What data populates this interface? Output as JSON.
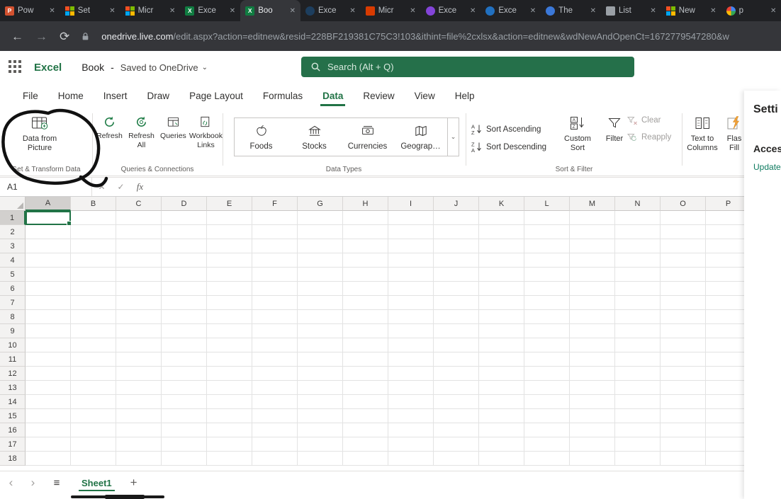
{
  "colors": {
    "excel_green": "#217346",
    "search_bg": "#25704a",
    "link": "#0e7a5f",
    "marker": "#111111"
  },
  "browser": {
    "tabs": [
      {
        "label": "Pow",
        "icon": "square",
        "color": "#d35230",
        "letter": "P"
      },
      {
        "label": "Set",
        "icon": "ms"
      },
      {
        "label": "Micr",
        "icon": "ms"
      },
      {
        "label": "Exce",
        "icon": "excel"
      },
      {
        "label": "Boo",
        "icon": "excel",
        "active": true
      },
      {
        "label": "Exce",
        "icon": "circle",
        "color": "#1d3e5e"
      },
      {
        "label": "Micr",
        "icon": "square",
        "color": "#d83b01"
      },
      {
        "label": "Exce",
        "icon": "circle",
        "color": "#8344d8"
      },
      {
        "label": "Exce",
        "icon": "circle",
        "color": "#2170c0"
      },
      {
        "label": "The",
        "icon": "circle",
        "color": "#3b78d8"
      },
      {
        "label": "List",
        "icon": "square",
        "color": "#9aa0a6"
      },
      {
        "label": "New",
        "icon": "ms"
      },
      {
        "label": "p",
        "icon": "google"
      }
    ],
    "close_glyph": "✕",
    "back_glyph": "←",
    "forward_glyph": "→",
    "reload_glyph": "⟳",
    "url_domain": "onedrive.live.com",
    "url_path": "/edit.aspx?action=editnew&resid=228BF219381C75C3!103&ithint=file%2cxlsx&action=editnew&wdNewAndOpenCt=1672779547280&w"
  },
  "app_header": {
    "app_name": "Excel",
    "doc_name": "Book",
    "dash": "-",
    "saved_status": "Saved to OneDrive",
    "chevron": "⌄",
    "search_placeholder": "Search (Alt + Q)"
  },
  "ribbon": {
    "tabs": [
      "File",
      "Home",
      "Insert",
      "Draw",
      "Page Layout",
      "Formulas",
      "Data",
      "Review",
      "View",
      "Help"
    ],
    "active_tab": "Data",
    "get_transform": {
      "button_line1": "Data from",
      "button_line2": "Picture",
      "group_label": "Get & Transform Data"
    },
    "queries": {
      "buttons": [
        [
          "Refresh"
        ],
        [
          "Refresh",
          "All"
        ],
        [
          "Queries"
        ],
        [
          "Workbook",
          "Links"
        ]
      ],
      "group_label": "Queries & Connections"
    },
    "data_types": {
      "items": [
        "Foods",
        "Stocks",
        "Currencies",
        "Geograp…"
      ],
      "group_label": "Data Types"
    },
    "sort_filter": {
      "asc": "Sort Ascending",
      "desc": "Sort Descending",
      "custom": [
        "Custom",
        "Sort"
      ],
      "filter": "Filter",
      "clear": "Clear",
      "reapply": "Reapply",
      "group_label": "Sort & Filter"
    },
    "text_to_columns": [
      "Text to",
      "Columns"
    ],
    "flash_fill": [
      "Flas",
      "Fill"
    ]
  },
  "formula_bar": {
    "name_box": "A1",
    "cancel_glyph": "✕",
    "enter_glyph": "✓",
    "fx_label": "fx"
  },
  "grid": {
    "columns": [
      "A",
      "B",
      "C",
      "D",
      "E",
      "F",
      "G",
      "H",
      "I",
      "J",
      "K",
      "L",
      "M",
      "N",
      "O",
      "P"
    ],
    "row_count": 18,
    "selected_cell": "A1",
    "selected_column": "A",
    "selected_row": 1
  },
  "sheet_bar": {
    "prev_glyph": "‹",
    "next_glyph": "›",
    "menu_glyph": "≡",
    "sheet_name": "Sheet1",
    "add_glyph": "+"
  },
  "side_panel": {
    "title": "Setti",
    "section": "Acces",
    "link": "Update"
  }
}
